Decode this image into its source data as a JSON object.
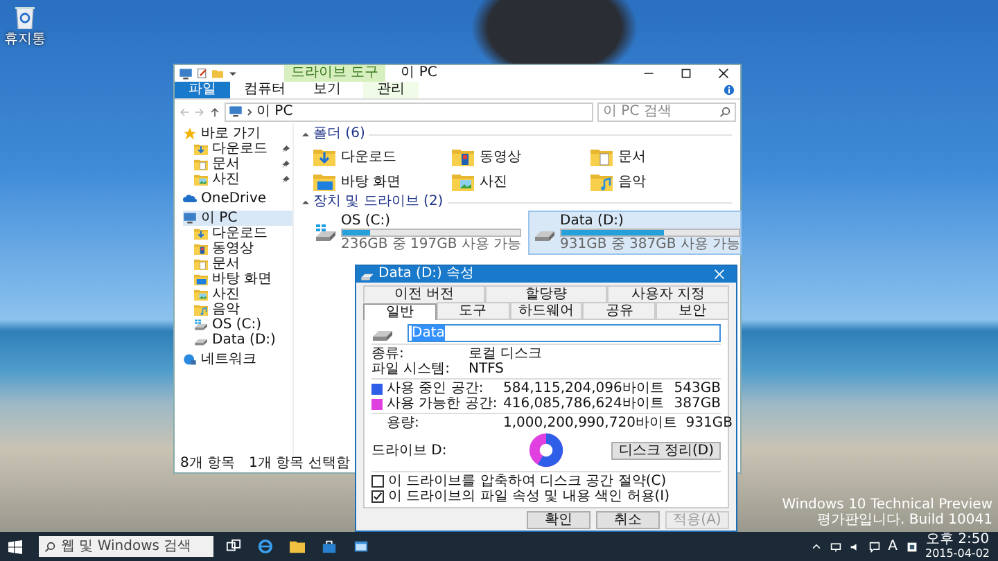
{
  "desktop": {
    "icons": [
      {
        "label": "휴지통"
      }
    ],
    "watermark": [
      "Windows 10 Technical Preview",
      "평가판입니다. Build 10041"
    ]
  },
  "explorer": {
    "context_tab": "드라이브 도구",
    "title": "이 PC",
    "ribbon_tabs": [
      {
        "label": "파일",
        "kind": "file"
      },
      {
        "label": "컴퓨터",
        "kind": "normal"
      },
      {
        "label": "보기",
        "kind": "normal"
      },
      {
        "label": "관리",
        "kind": "context"
      }
    ],
    "address": "이 PC",
    "search": {
      "placeholder": "이 PC 검색"
    },
    "nav": [
      {
        "label": "바로 가기",
        "kind": "star",
        "selected": false,
        "children": [
          {
            "label": "다운로드",
            "kind": "download",
            "selected": false,
            "pinned": true
          },
          {
            "label": "문서",
            "kind": "docs",
            "selected": false,
            "pinned": true
          },
          {
            "label": "사진",
            "kind": "pictures",
            "selected": false,
            "pinned": true
          }
        ]
      },
      {
        "label": "OneDrive",
        "kind": "cloud",
        "selected": false
      },
      {
        "label": "이 PC",
        "kind": "pc",
        "selected": true,
        "children": [
          {
            "label": "다운로드",
            "kind": "download",
            "selected": false
          },
          {
            "label": "동영상",
            "kind": "videos",
            "selected": false
          },
          {
            "label": "문서",
            "kind": "docs",
            "selected": false
          },
          {
            "label": "바탕 화면",
            "kind": "desktop",
            "selected": false
          },
          {
            "label": "사진",
            "kind": "pictures",
            "selected": false
          },
          {
            "label": "음악",
            "kind": "music",
            "selected": false
          },
          {
            "label": "OS (C:)",
            "kind": "os",
            "selected": false
          },
          {
            "label": "Data (D:)",
            "kind": "data",
            "selected": false
          }
        ]
      },
      {
        "label": "네트워크",
        "kind": "network",
        "selected": false
      }
    ],
    "folders": {
      "title": "폴더 (6)",
      "items": [
        {
          "label": "다운로드",
          "kind": "download"
        },
        {
          "label": "동영상",
          "kind": "videos"
        },
        {
          "label": "문서",
          "kind": "docs"
        },
        {
          "label": "바탕 화면",
          "kind": "desktop"
        },
        {
          "label": "사진",
          "kind": "pictures"
        },
        {
          "label": "음악",
          "kind": "music"
        }
      ]
    },
    "drives": {
      "title": "장치 및 드라이브 (2)",
      "items": [
        {
          "label": "OS (C:)",
          "kind": "os",
          "level": 0.16,
          "info": "236GB 중 197GB 사용 가능",
          "selected": false
        },
        {
          "label": "Data (D:)",
          "kind": "data",
          "level": 0.58,
          "info": "931GB 중 387GB 사용 가능",
          "selected": true
        }
      ]
    },
    "status": [
      "8개 항목",
      "1개 항목 선택함"
    ]
  },
  "dialog": {
    "title": "Data (D:) 속성",
    "tabs_back": [
      {
        "label": "이전 버전",
        "selected": false
      },
      {
        "label": "할당량",
        "selected": false
      },
      {
        "label": "사용자 지정",
        "selected": false
      }
    ],
    "tabs_front": [
      {
        "label": "일반",
        "selected": true
      },
      {
        "label": "도구",
        "selected": false
      },
      {
        "label": "하드웨어",
        "selected": false
      },
      {
        "label": "공유",
        "selected": false
      },
      {
        "label": "보안",
        "selected": false
      }
    ],
    "name": "Data",
    "rows": [
      {
        "label": "종류:",
        "value": "로컬 디스크"
      },
      {
        "label": "파일 시스템:",
        "value": "NTFS"
      }
    ],
    "usage": [
      {
        "label": "사용 중인 공간:",
        "bytes": "584,115,204,096바이트",
        "size": "543GB",
        "color": "#2f5fe8"
      },
      {
        "label": "사용 가능한 공간:",
        "bytes": "416,085,786,624바이트",
        "size": "387GB",
        "color": "#e040e0"
      }
    ],
    "capacity": {
      "label": "용량:",
      "bytes": "1,000,200,990,720바이트",
      "size": "931GB"
    },
    "drive_label": "드라이브 D:",
    "cleanup_button": "디스크 정리(D)",
    "options": [
      {
        "label": "이 드라이브를 압축하여 디스크 공간 절약(C)",
        "checked": false
      },
      {
        "label": "이 드라이브의 파일 속성 및 내용 색인 허용(I)",
        "checked": true
      }
    ],
    "buttons": [
      {
        "label": "확인",
        "disabled": false
      },
      {
        "label": "취소",
        "disabled": false
      },
      {
        "label": "적용(A)",
        "disabled": true
      }
    ]
  },
  "taskbar": {
    "search": {
      "placeholder": "웹 및 Windows 검색"
    },
    "apps": [
      {
        "kind": "taskview"
      },
      {
        "kind": "browser"
      },
      {
        "kind": "explorer"
      },
      {
        "kind": "store"
      },
      {
        "kind": "app"
      }
    ],
    "ime": "A",
    "time": "오후 2:50",
    "date": "2015-04-02"
  }
}
